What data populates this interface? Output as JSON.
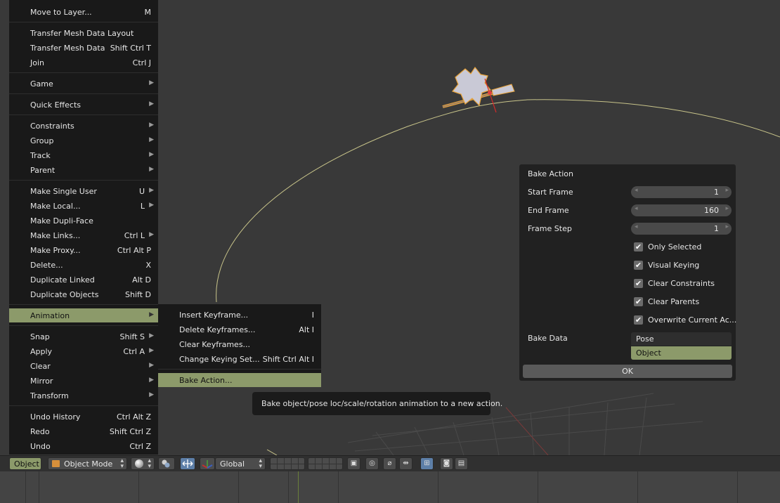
{
  "object_menu": {
    "items": [
      {
        "label": "Move to Layer...",
        "shortcut": "M",
        "submenu": false
      },
      {
        "label": "Transfer Mesh Data Layout",
        "shortcut": "",
        "submenu": false
      },
      {
        "label": "Transfer Mesh Data",
        "shortcut": "Shift Ctrl T",
        "submenu": false
      },
      {
        "label": "Join",
        "shortcut": "Ctrl J",
        "submenu": false
      },
      {
        "label": "Game",
        "shortcut": "",
        "submenu": true
      },
      {
        "label": "Quick Effects",
        "shortcut": "",
        "submenu": true
      },
      {
        "label": "Constraints",
        "shortcut": "",
        "submenu": true
      },
      {
        "label": "Group",
        "shortcut": "",
        "submenu": true
      },
      {
        "label": "Track",
        "shortcut": "",
        "submenu": true
      },
      {
        "label": "Parent",
        "shortcut": "",
        "submenu": true
      },
      {
        "label": "Make Single User",
        "shortcut": "U",
        "submenu": true
      },
      {
        "label": "Make Local...",
        "shortcut": "L",
        "submenu": true
      },
      {
        "label": "Make Dupli-Face",
        "shortcut": "",
        "submenu": false
      },
      {
        "label": "Make Links...",
        "shortcut": "Ctrl L",
        "submenu": true
      },
      {
        "label": "Make Proxy...",
        "shortcut": "Ctrl Alt P",
        "submenu": false
      },
      {
        "label": "Delete...",
        "shortcut": "X",
        "submenu": false
      },
      {
        "label": "Duplicate Linked",
        "shortcut": "Alt D",
        "submenu": false
      },
      {
        "label": "Duplicate Objects",
        "shortcut": "Shift D",
        "submenu": false
      },
      {
        "label": "Animation",
        "shortcut": "",
        "submenu": true,
        "active": true
      },
      {
        "label": "Snap",
        "shortcut": "Shift S",
        "submenu": true
      },
      {
        "label": "Apply",
        "shortcut": "Ctrl A",
        "submenu": true
      },
      {
        "label": "Clear",
        "shortcut": "",
        "submenu": true
      },
      {
        "label": "Mirror",
        "shortcut": "",
        "submenu": true
      },
      {
        "label": "Transform",
        "shortcut": "",
        "submenu": true
      },
      {
        "label": "Undo History",
        "shortcut": "Ctrl Alt Z",
        "submenu": false
      },
      {
        "label": "Redo",
        "shortcut": "Shift Ctrl Z",
        "submenu": false
      },
      {
        "label": "Undo",
        "shortcut": "Ctrl Z",
        "submenu": false
      }
    ]
  },
  "animation_submenu": {
    "items": [
      {
        "label": "Insert Keyframe...",
        "shortcut": "I"
      },
      {
        "label": "Delete Keyframes...",
        "shortcut": "Alt I"
      },
      {
        "label": "Clear Keyframes...",
        "shortcut": ""
      },
      {
        "label": "Change Keying Set...",
        "shortcut": "Shift Ctrl Alt I"
      },
      {
        "label": "Bake Action...",
        "shortcut": "",
        "active": true
      }
    ]
  },
  "tooltip": {
    "text": "Bake object/pose loc/scale/rotation animation to a new action."
  },
  "bake_panel": {
    "title": "Bake Action",
    "start_frame": {
      "label": "Start Frame",
      "value": "1"
    },
    "end_frame": {
      "label": "End Frame",
      "value": "160"
    },
    "frame_step": {
      "label": "Frame Step",
      "value": "1"
    },
    "checkboxes": [
      {
        "label": "Only Selected",
        "checked": true
      },
      {
        "label": "Visual Keying",
        "checked": true
      },
      {
        "label": "Clear Constraints",
        "checked": true
      },
      {
        "label": "Clear Parents",
        "checked": true
      },
      {
        "label": "Overwrite Current Ac...",
        "checked": true
      }
    ],
    "bake_data": {
      "label": "Bake Data",
      "options": [
        "Pose",
        "Object"
      ],
      "selected": "Object"
    },
    "ok_label": "OK"
  },
  "header": {
    "mode_menu": "Object",
    "interaction_mode": "Object Mode",
    "orientation": "Global"
  },
  "colors": {
    "menu_bg": "#191919",
    "highlight": "#8c9a6a",
    "viewport_bg": "#393939",
    "selection_outline": "#e8a33a",
    "motion_path": "#c8c48a",
    "mode_icon": "#d7903b"
  }
}
